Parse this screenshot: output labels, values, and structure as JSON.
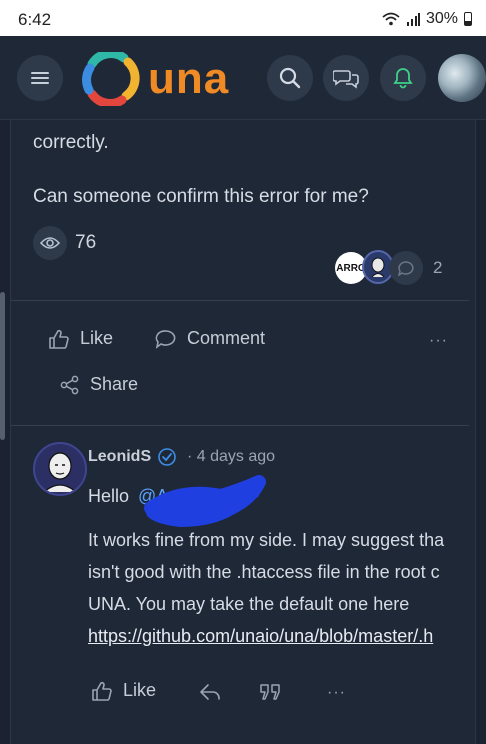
{
  "status": {
    "time": "6:42",
    "battery": "30%"
  },
  "header": {
    "logo_text": "una"
  },
  "post": {
    "text_line1": "correctly.",
    "text_line2": "Can someone confirm this error for me?",
    "views": "76",
    "reaction_count": "2",
    "reactor_label": "ARRO"
  },
  "actions": {
    "like": "Like",
    "comment": "Comment",
    "share": "Share",
    "more": "···"
  },
  "comment": {
    "author": "LeonidS",
    "time": "· 4 days ago",
    "greeting": "Hello",
    "mention": "@A",
    "line1": "It works fine from my side. I may suggest tha",
    "line2": "isn't good with the .htaccess file in the root c",
    "line3": "UNA. You may take the default one here",
    "link": "https://github.com/unaio/una/blob/master/.h",
    "like": "Like",
    "more": "···"
  }
}
